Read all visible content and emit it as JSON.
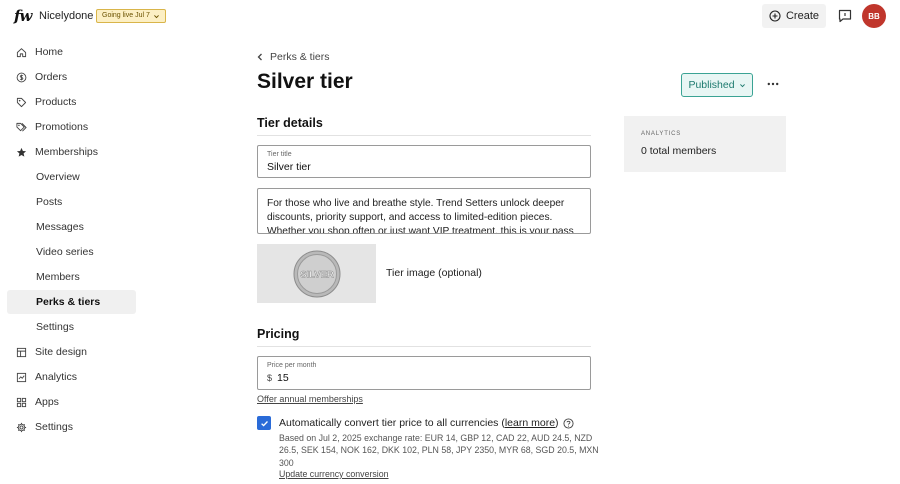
{
  "brand": {
    "logo": "fw",
    "site_name": "Nicelydone",
    "go_live_badge": "Going live Jul 7"
  },
  "topbar": {
    "create_label": "Create",
    "avatar_initials": "BB"
  },
  "sidebar": {
    "items": [
      {
        "label": "Home",
        "icon": "home-icon"
      },
      {
        "label": "Orders",
        "icon": "dollar-circle-icon"
      },
      {
        "label": "Products",
        "icon": "tag-icon"
      },
      {
        "label": "Promotions",
        "icon": "tags-icon"
      },
      {
        "label": "Memberships",
        "icon": "star-icon"
      },
      {
        "label": "Overview"
      },
      {
        "label": "Posts"
      },
      {
        "label": "Messages"
      },
      {
        "label": "Video series"
      },
      {
        "label": "Members"
      },
      {
        "label": "Perks & tiers",
        "active": true
      },
      {
        "label": "Settings"
      },
      {
        "label": "Site design",
        "icon": "layout-icon"
      },
      {
        "label": "Analytics",
        "icon": "chart-icon"
      },
      {
        "label": "Apps",
        "icon": "apps-icon"
      },
      {
        "label": "Settings",
        "icon": "gear-icon"
      }
    ]
  },
  "page": {
    "breadcrumb": "Perks & tiers",
    "title": "Silver tier",
    "status": "Published"
  },
  "tier_details": {
    "heading": "Tier details",
    "title_label": "Tier title",
    "title_value": "Silver tier",
    "description": "For those who live and breathe style. Trend Setters unlock deeper discounts, priority support, and access to limited-edition pieces. Whether you shop often or just want VIP treatment, this is your pass to",
    "image_label": "Tier image (optional)",
    "coin_text": "SILVER"
  },
  "pricing": {
    "heading": "Pricing",
    "price_label": "Price per month",
    "currency_symbol": "$",
    "price_value": "15",
    "offer_annual": "Offer annual memberships",
    "convert_prefix": "Automatically convert tier price to all currencies (",
    "convert_link": "learn more",
    "convert_suffix": ")",
    "rate_text": "Based on Jul 2, 2025 exchange rate: EUR 14, GBP 12, CAD 22, AUD 24.5, NZD 26.5, SEK 154, NOK 162, DKK 102, PLN 58, JPY 2350, MYR 68, SGD 20.5, MXN 300",
    "update_link": "Update currency conversion"
  },
  "analytics": {
    "label": "ANALYTICS",
    "value": "0 total members"
  },
  "colors": {
    "accent_blue": "#2a6bd8",
    "published_green": "#3aa394",
    "avatar_red": "#c0362c",
    "badge_yellow": "#fcefc4"
  }
}
